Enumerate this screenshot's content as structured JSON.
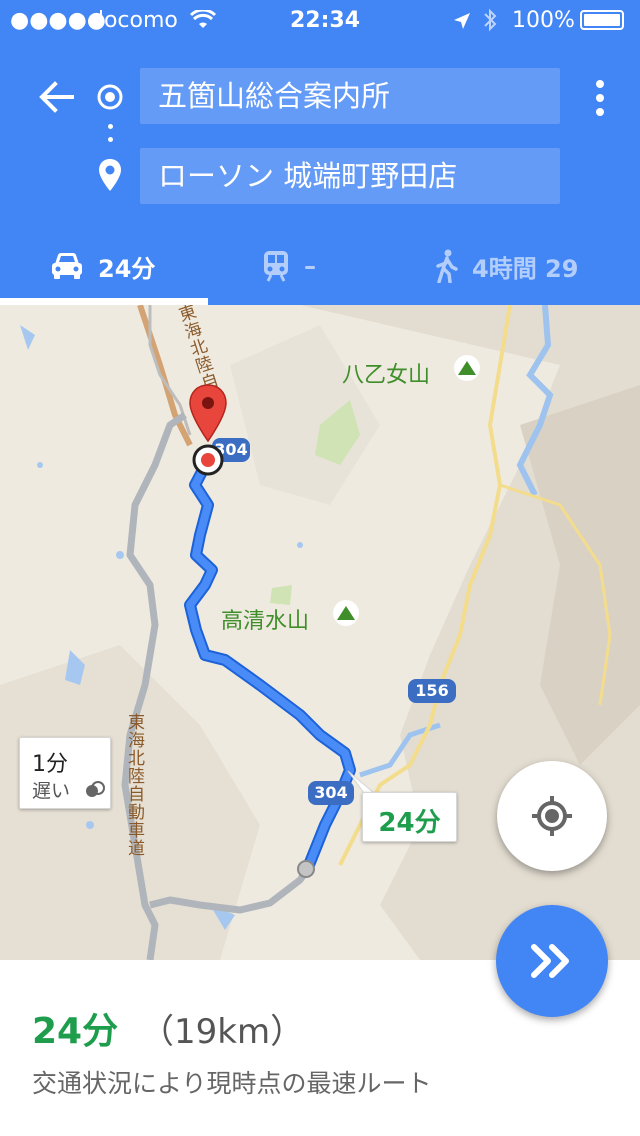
{
  "status_bar": {
    "carrier": "docomo",
    "time": "22:34",
    "battery": "100%"
  },
  "directions": {
    "origin": "五箇山総合案内所",
    "destination": "ローソン 城端町野田店"
  },
  "modes": [
    {
      "id": "drive",
      "icon": "car-icon",
      "label": "24分",
      "selected": true
    },
    {
      "id": "transit",
      "icon": "train-icon",
      "label": "–",
      "selected": false
    },
    {
      "id": "walk",
      "icon": "walk-icon",
      "label": "4時間 29",
      "selected": false
    }
  ],
  "map": {
    "labels": {
      "mountain_1": "八乙女山",
      "mountain_2": "高清水山",
      "expressway": "東海北陸自動車道",
      "expressway_top": "東海北陸自"
    },
    "route_shields": {
      "r304_top": "304",
      "r304_bottom": "304",
      "r156": "156"
    },
    "callouts": {
      "main_time": "24分",
      "alt_time": "1分",
      "alt_note": "遅い"
    }
  },
  "summary": {
    "time": "24分",
    "distance": "（19km）",
    "note": "交通状況により現時点の最速ルート"
  },
  "colors": {
    "header": "#4285f4",
    "route": "#4285f4",
    "green_text": "#1e9e4d"
  }
}
